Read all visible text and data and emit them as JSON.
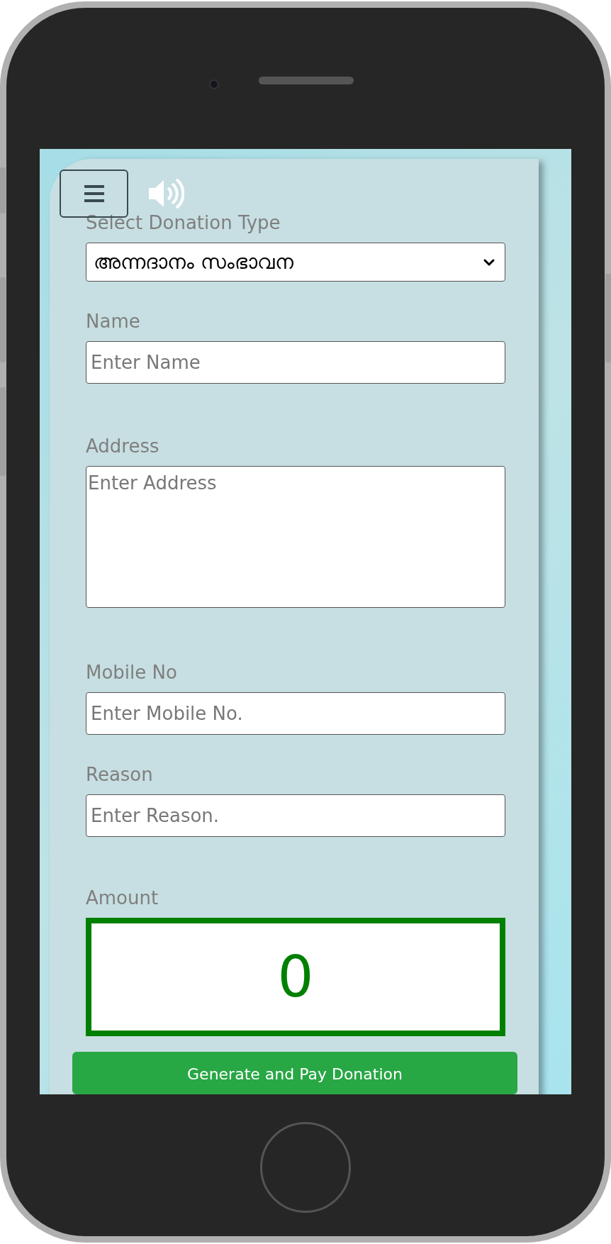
{
  "form": {
    "fields": [
      {
        "kind": "select",
        "label": "Select Donation Type",
        "value": "അന്നദാനം സംഭാവന"
      },
      {
        "kind": "input",
        "label": "Name",
        "placeholder": "Enter Name"
      },
      {
        "kind": "textarea",
        "label": "Address",
        "placeholder": "Enter Address"
      },
      {
        "kind": "input",
        "label": "Mobile No",
        "placeholder": "Enter Mobile No."
      },
      {
        "kind": "input",
        "label": "Reason",
        "placeholder": "Enter Reason."
      }
    ],
    "amount": {
      "label": "Amount",
      "value": "0"
    },
    "submit_button": "Generate and Pay Donation"
  }
}
